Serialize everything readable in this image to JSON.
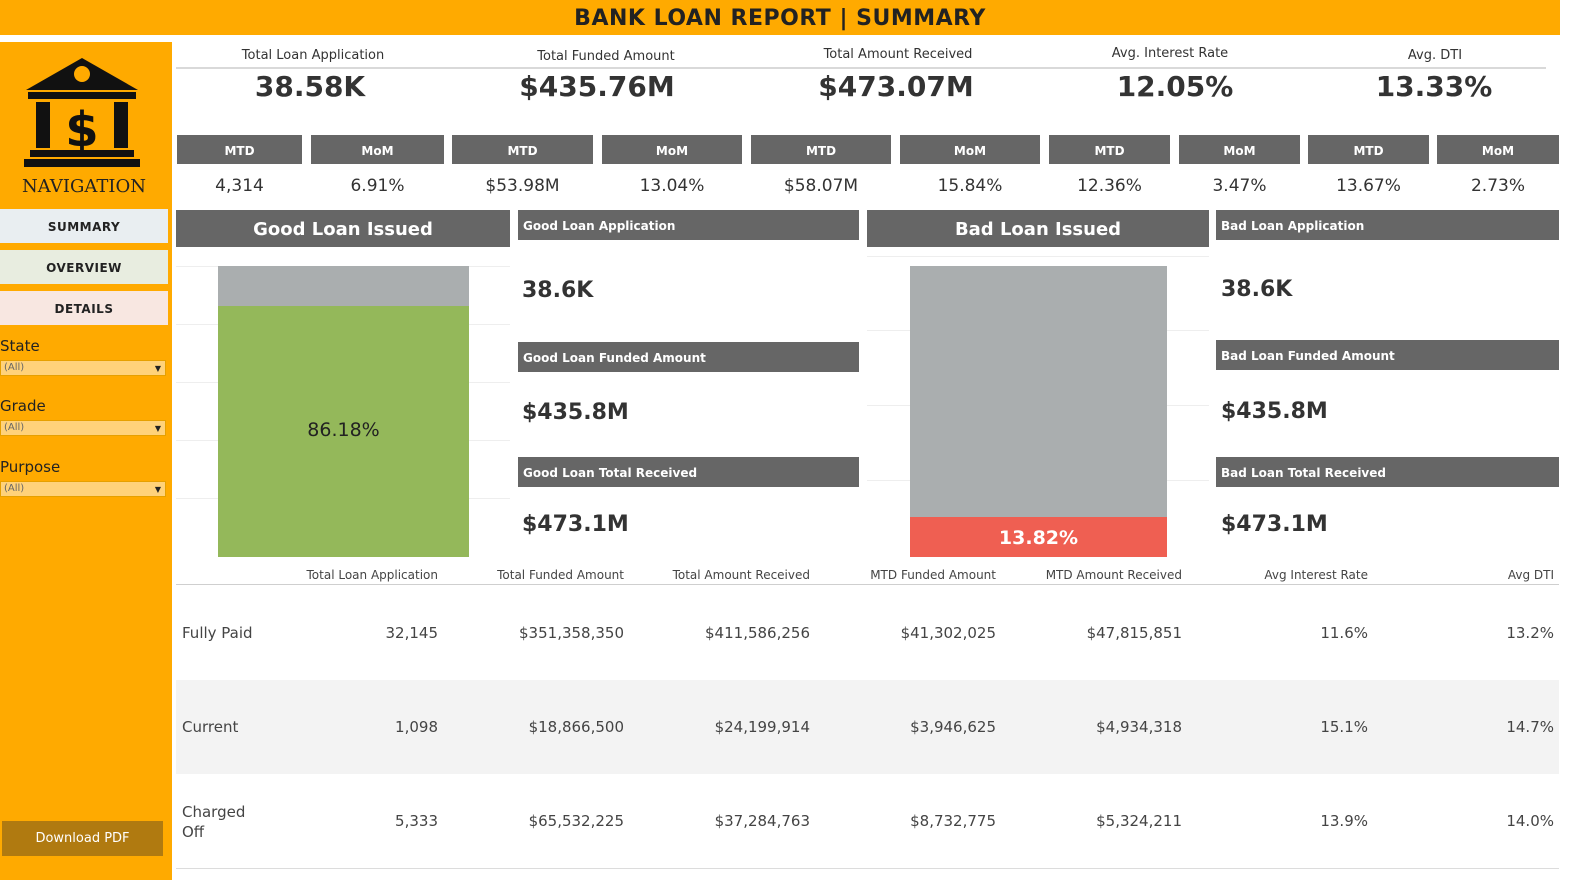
{
  "title": "BANK LOAN REPORT | SUMMARY",
  "colors": {
    "brand": "#FFAA00",
    "header_gray": "#666666",
    "good": "#94B85A",
    "bad": "#EF5F52",
    "neutral": "#AAAEAF"
  },
  "sidebar": {
    "nav_label": "NAVIGATION",
    "logo_icon": "bank-dollar-icon",
    "nav": [
      {
        "label": "SUMMARY",
        "bg": "#E9EEF1"
      },
      {
        "label": "OVERVIEW",
        "bg": "#E8EDE0"
      },
      {
        "label": "DETAILS",
        "bg": "#F8E7E1"
      }
    ],
    "filters": [
      {
        "label": "State",
        "value": "(All)"
      },
      {
        "label": "Grade",
        "value": "(All)"
      },
      {
        "label": "Purpose",
        "value": "(All)"
      }
    ],
    "download_label": "Download PDF"
  },
  "kpis": [
    {
      "label": "Total Loan Application",
      "value": "38.58K",
      "mtd_label": "MTD",
      "mtd": "4,314",
      "mom_label": "MoM",
      "mom": "6.91%"
    },
    {
      "label": "Total Funded Amount",
      "value": "$435.76M",
      "mtd_label": "MTD",
      "mtd": "$53.98M",
      "mom_label": "MoM",
      "mom": "13.04%"
    },
    {
      "label": "Total Amount Received",
      "value": "$473.07M",
      "mtd_label": "MTD",
      "mtd": "$58.07M",
      "mom_label": "MoM",
      "mom": "15.84%"
    },
    {
      "label": "Avg. Interest Rate",
      "value": "12.05%",
      "mtd_label": "MTD",
      "mtd": "12.36%",
      "mom_label": "MoM",
      "mom": "3.47%"
    },
    {
      "label": "Avg. DTI",
      "value": "13.33%",
      "mtd_label": "MTD",
      "mtd": "13.67%",
      "mom_label": "MoM",
      "mom": "2.73%"
    }
  ],
  "good": {
    "title": "Good Loan Issued",
    "percent_label": "86.18%",
    "percent": 86.18,
    "application_label": "Good Loan Application",
    "application_value": "38.6K",
    "funded_label": "Good Loan Funded Amount",
    "funded_value": "$435.8M",
    "received_label": "Good Loan Total Received",
    "received_value": "$473.1M"
  },
  "bad": {
    "title": "Bad Loan Issued",
    "percent_label": "13.82%",
    "percent": 13.82,
    "application_label": "Bad Loan Application",
    "application_value": "38.6K",
    "funded_label": "Bad Loan Funded Amount",
    "funded_value": "$435.8M",
    "received_label": "Bad Loan Total Received",
    "received_value": "$473.1M"
  },
  "table": {
    "columns": [
      "Total Loan Application",
      "Total Funded Amount",
      "Total Amount Received",
      "MTD Funded Amount",
      "MTD Amount Received",
      "Avg Interest Rate",
      "Avg DTI"
    ],
    "rows": [
      {
        "status": "Fully Paid",
        "cells": [
          "32,145",
          "$351,358,350",
          "$411,586,256",
          "$41,302,025",
          "$47,815,851",
          "11.6%",
          "13.2%"
        ]
      },
      {
        "status": "Current",
        "cells": [
          "1,098",
          "$18,866,500",
          "$24,199,914",
          "$3,946,625",
          "$4,934,318",
          "15.1%",
          "14.7%"
        ]
      },
      {
        "status": "Charged Off",
        "status_lines": [
          "Charged",
          "Off"
        ],
        "cells": [
          "5,333",
          "$65,532,225",
          "$37,284,763",
          "$8,732,775",
          "$5,324,211",
          "13.9%",
          "14.0%"
        ]
      }
    ]
  }
}
